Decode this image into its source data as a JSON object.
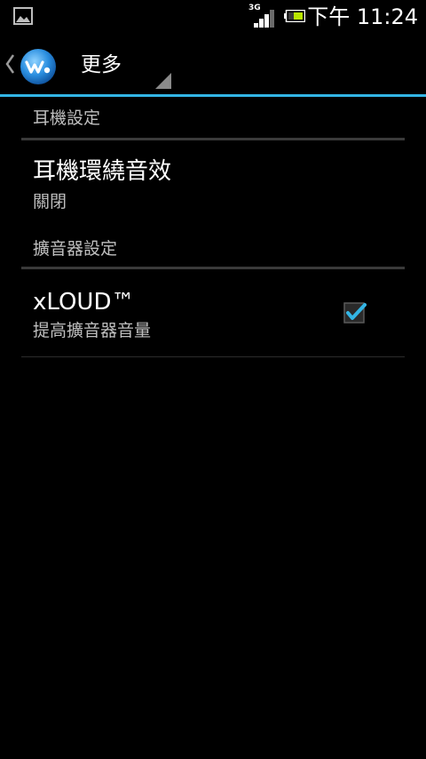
{
  "status_bar": {
    "network_type": "3G",
    "time": "下午 11:24",
    "icons": [
      "gallery-icon",
      "signal-icon",
      "battery-icon"
    ]
  },
  "action_bar": {
    "title": "更多",
    "logo": "walkman-logo-icon",
    "accent_color": "#33b5e5"
  },
  "sections": [
    {
      "title": "耳機設定",
      "items": [
        {
          "title": "耳機環繞音效",
          "summary": "關閉"
        }
      ]
    },
    {
      "title": "擴音器設定",
      "items": [
        {
          "title": "xLOUD™",
          "summary": "提高擴音器音量",
          "checked": true
        }
      ]
    }
  ]
}
